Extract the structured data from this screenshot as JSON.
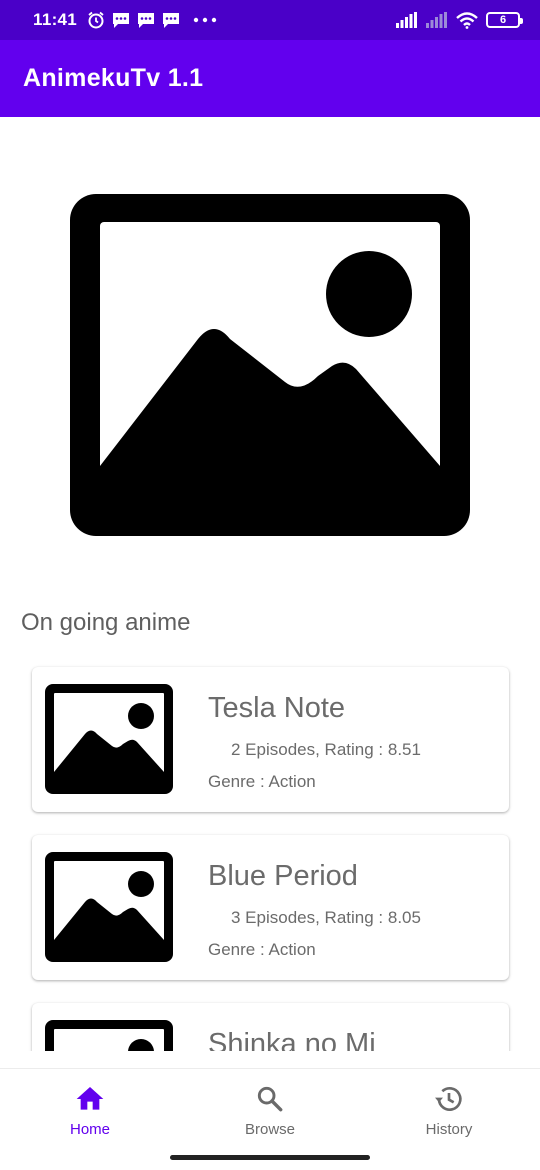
{
  "status_bar": {
    "time": "11:41",
    "battery": "6",
    "icons_left": [
      "alarm-icon",
      "message-icon",
      "message-icon",
      "message-icon",
      "more-icon"
    ],
    "icons_right": [
      "signal-icon",
      "signal-icon",
      "wifi-icon",
      "battery-icon"
    ]
  },
  "app_bar": {
    "title": "AnimekuTv 1.1",
    "color": "#6200ee"
  },
  "hero": {
    "icon": "image-placeholder-icon"
  },
  "section": {
    "title": "On going anime"
  },
  "anime_list": [
    {
      "title": "Tesla Note",
      "meta": "2 Episodes, Rating : 8.51",
      "genre": "Genre : Action"
    },
    {
      "title": "Blue Period",
      "meta": "3 Episodes, Rating : 8.05",
      "genre": "Genre : Action"
    },
    {
      "title": "Shinka no Mi",
      "meta": "",
      "genre": ""
    }
  ],
  "bottom_nav": {
    "home": {
      "label": "Home",
      "icon": "home-icon",
      "active": true
    },
    "browse": {
      "label": "Browse",
      "icon": "search-icon"
    },
    "history": {
      "label": "History",
      "icon": "history-icon"
    },
    "accent": "#6200ee"
  }
}
